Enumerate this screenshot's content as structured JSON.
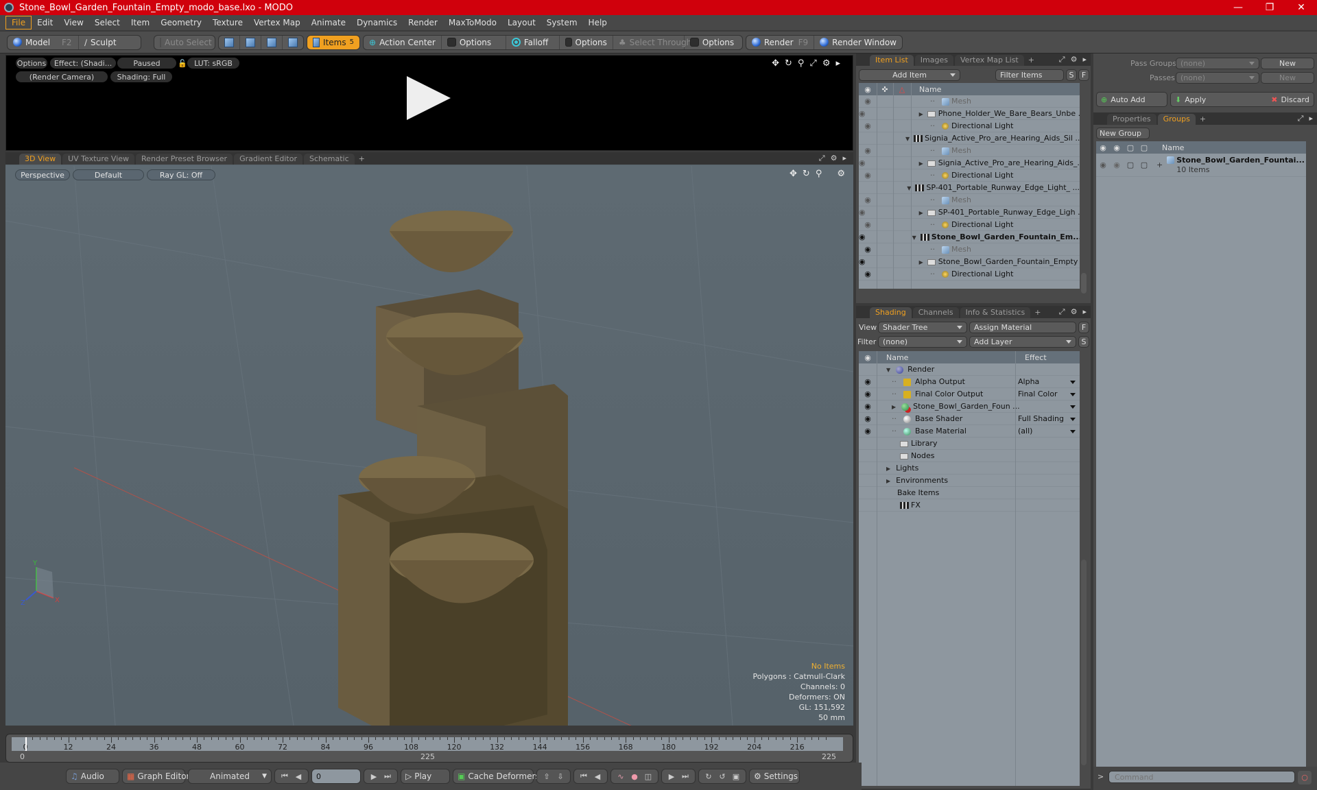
{
  "window": {
    "title": "Stone_Bowl_Garden_Fountain_Empty_modo_base.lxo - MODO",
    "controls": [
      "minimize",
      "restore",
      "close"
    ]
  },
  "menu": [
    "File",
    "Edit",
    "View",
    "Select",
    "Item",
    "Geometry",
    "Texture",
    "Vertex Map",
    "Animate",
    "Dynamics",
    "Render",
    "MaxToModo",
    "Layout",
    "System",
    "Help"
  ],
  "menu_active": "File",
  "toolbar": {
    "model": "Model",
    "model_key": "F2",
    "sculpt": "Sculpt",
    "auto_select": "Auto Select",
    "items": "Items",
    "items_count": "5",
    "action_center": "Action Center",
    "options1": "Options",
    "falloff": "Falloff",
    "options2": "Options",
    "select_through": "Select Through",
    "options3": "Options",
    "render": "Render",
    "render_key": "F9",
    "render_window": "Render Window"
  },
  "preview": {
    "options": "Options",
    "effect": "Effect: (Shadi...",
    "status": "Paused",
    "lut": "LUT: sRGB",
    "camera": "(Render Camera)",
    "shading": "Shading: Full"
  },
  "viewport_tabs": [
    "3D View",
    "UV Texture View",
    "Render Preset Browser",
    "Gradient Editor",
    "Schematic",
    "+"
  ],
  "viewport": {
    "projection": "Perspective",
    "style": "Default",
    "raygl": "Ray GL: Off",
    "hud": {
      "selection": "No Items",
      "polygons": "Polygons : Catmull-Clark",
      "channels": "Channels: 0",
      "deformers": "Deformers: ON",
      "gl": "GL: 151,592",
      "focal": "50 mm"
    },
    "axis_labels": {
      "x": "X",
      "y": "Y",
      "z": "Z"
    }
  },
  "item_list": {
    "tabs": [
      "Item List",
      "Images",
      "Vertex Map List",
      "+"
    ],
    "add_item": "Add Item",
    "filter": "Filter Items",
    "s_btn": "S",
    "f_btn": "F",
    "header_name": "Name",
    "rows": [
      {
        "name": "Mesh",
        "type": "mesh",
        "indent": 2,
        "visible": "dim",
        "expander": ""
      },
      {
        "name": "Phone_Holder_We_Bare_Bears_Unbe ...",
        "type": "folder",
        "indent": 2,
        "visible": "dim",
        "expander": "▶"
      },
      {
        "name": "Directional Light",
        "type": "light",
        "indent": 2,
        "visible": "dim",
        "expander": ""
      },
      {
        "name": "Signia_Active_Pro_are_Hearing_Aids_Sil ...",
        "type": "scene",
        "indent": 1,
        "visible": "none",
        "expander": "▼"
      },
      {
        "name": "Mesh",
        "type": "mesh",
        "indent": 2,
        "visible": "dim",
        "expander": ""
      },
      {
        "name": "Signia_Active_Pro_are_Hearing_Aids_...",
        "type": "folder",
        "indent": 2,
        "visible": "dim",
        "expander": "▶"
      },
      {
        "name": "Directional Light",
        "type": "light",
        "indent": 2,
        "visible": "dim",
        "expander": ""
      },
      {
        "name": "SP-401_Portable_Runway_Edge_Light_ ...",
        "type": "scene",
        "indent": 1,
        "visible": "none",
        "expander": "▼"
      },
      {
        "name": "Mesh",
        "type": "mesh",
        "indent": 2,
        "visible": "dim",
        "expander": ""
      },
      {
        "name": "SP-401_Portable_Runway_Edge_Ligh ...",
        "type": "folder",
        "indent": 2,
        "visible": "dim",
        "expander": "▶"
      },
      {
        "name": "Directional Light",
        "type": "light",
        "indent": 2,
        "visible": "dim",
        "expander": ""
      },
      {
        "name": "Stone_Bowl_Garden_Fountain_Em...",
        "type": "scene",
        "indent": 1,
        "visible": "on",
        "expander": "▼",
        "bold": true
      },
      {
        "name": "Mesh",
        "type": "mesh",
        "indent": 2,
        "visible": "on",
        "expander": ""
      },
      {
        "name": "Stone_Bowl_Garden_Fountain_Empty ...",
        "type": "folder",
        "indent": 2,
        "visible": "on",
        "expander": "▶"
      },
      {
        "name": "Directional Light",
        "type": "light",
        "indent": 2,
        "visible": "on",
        "expander": ""
      }
    ]
  },
  "shading": {
    "tabs": [
      "Shading",
      "Channels",
      "Info & Statistics",
      "+"
    ],
    "view_label": "View",
    "view_value": "Shader Tree",
    "assign_material": "Assign Material",
    "f_btn": "F",
    "filter_label": "Filter",
    "filter_value": "(none)",
    "add_layer": "Add Layer",
    "s_btn": "S",
    "header_name": "Name",
    "header_effect": "Effect",
    "rows": [
      {
        "name": "Render",
        "icon": "render-ball",
        "indent": 0,
        "expander": "▼",
        "effect": "",
        "eye": false,
        "dropdown": false
      },
      {
        "name": "Alpha Output",
        "icon": "output",
        "indent": 1,
        "expander": "",
        "effect": "Alpha",
        "eye": true,
        "dropdown": true
      },
      {
        "name": "Final Color Output",
        "icon": "output",
        "indent": 1,
        "expander": "",
        "effect": "Final Color",
        "eye": true,
        "dropdown": true
      },
      {
        "name": "Stone_Bowl_Garden_Foun ...",
        "icon": "material-group",
        "indent": 1,
        "expander": "▶",
        "effect": "",
        "eye": true,
        "dropdown": true
      },
      {
        "name": "Base Shader",
        "icon": "shader",
        "indent": 1,
        "expander": "",
        "effect": "Full Shading",
        "eye": true,
        "dropdown": true
      },
      {
        "name": "Base Material",
        "icon": "material",
        "indent": 1,
        "expander": "",
        "effect": "(all)",
        "eye": true,
        "dropdown": true
      },
      {
        "name": "Library",
        "icon": "folder",
        "indent": 0.5,
        "expander": "",
        "effect": "",
        "eye": false,
        "dropdown": false
      },
      {
        "name": "Nodes",
        "icon": "folder",
        "indent": 0.5,
        "expander": "",
        "effect": "",
        "eye": false,
        "dropdown": false
      },
      {
        "name": "Lights",
        "icon": "",
        "indent": 0,
        "expander": "▶",
        "effect": "",
        "eye": false,
        "dropdown": false
      },
      {
        "name": "Environments",
        "icon": "",
        "indent": 0,
        "expander": "▶",
        "effect": "",
        "eye": false,
        "dropdown": false
      },
      {
        "name": "Bake Items",
        "icon": "",
        "indent": 0,
        "expander": "",
        "effect": "",
        "eye": false,
        "dropdown": false
      },
      {
        "name": "FX",
        "icon": "clapper",
        "indent": 0.5,
        "expander": "",
        "effect": "",
        "eye": false,
        "dropdown": false
      }
    ]
  },
  "passes": {
    "pass_groups_label": "Pass Groups",
    "pass_groups_value": "(none)",
    "passes_label": "Passes",
    "passes_value": "(none)",
    "new": "New",
    "auto_add": "Auto Add",
    "apply": "Apply",
    "discard": "Discard"
  },
  "groups": {
    "tabs": [
      "Properties",
      "Groups",
      "+"
    ],
    "new_group": "New Group",
    "header_name": "Name",
    "items": [
      {
        "name": "Stone_Bowl_Garden_Fountai...",
        "count": "10 Items"
      }
    ]
  },
  "timeline": {
    "ticks": [
      0,
      12,
      24,
      36,
      48,
      60,
      72,
      84,
      96,
      108,
      120,
      132,
      144,
      156,
      168,
      180,
      192,
      204,
      216
    ],
    "start": "0",
    "end": "225",
    "range_end_label": "225",
    "current_frame": 0,
    "max_frame": 225
  },
  "transport": {
    "audio": "Audio",
    "graph_editor": "Graph Editor",
    "mode": "Animated",
    "frame": "0",
    "play": "Play",
    "cache_deformers": "Cache Deformers",
    "settings": "Settings"
  },
  "command": {
    "prompt": ">",
    "placeholder": "Command"
  }
}
